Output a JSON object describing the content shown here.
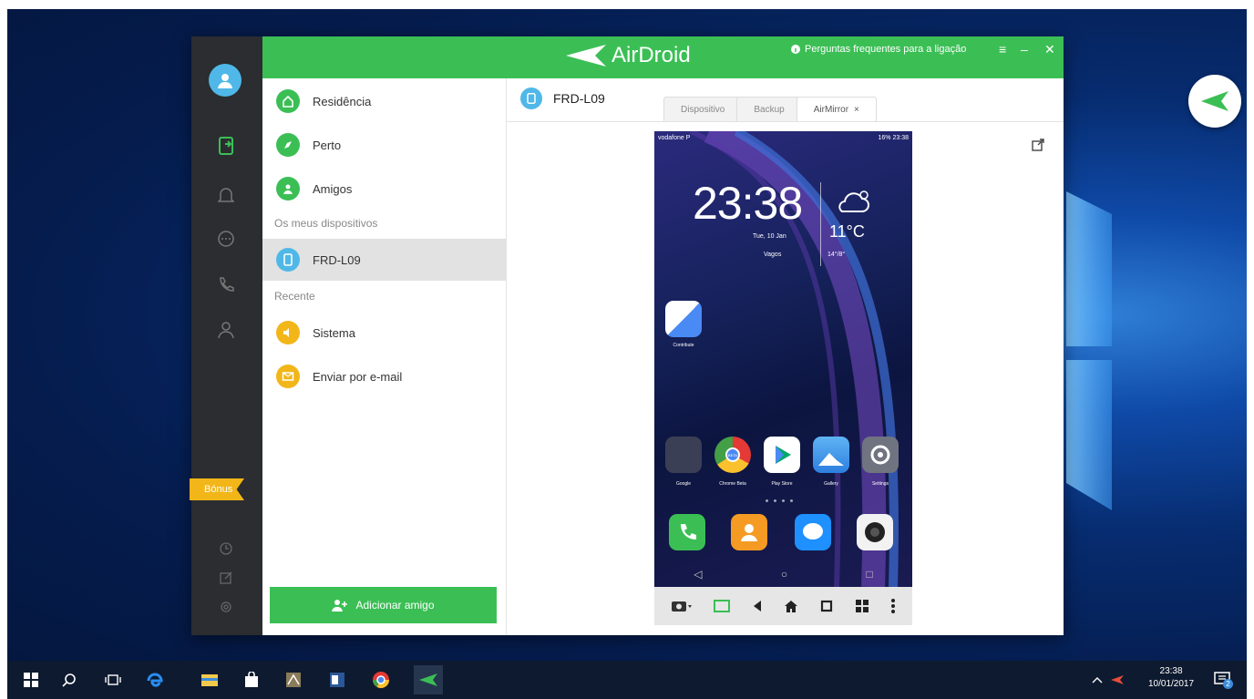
{
  "app": {
    "brand": "AirDroid",
    "faq_label": "Perguntas frequentes para a ligação",
    "window_controls": [
      "≡",
      "–",
      "✕"
    ],
    "bonus_label": "Bónus"
  },
  "sidebar": {
    "items": [
      {
        "label": "Residência",
        "color": "#3bbf55",
        "icon": "home-icon"
      },
      {
        "label": "Perto",
        "color": "#3bbf55",
        "icon": "compass-icon"
      },
      {
        "label": "Amigos",
        "color": "#3bbf55",
        "icon": "friends-icon"
      }
    ],
    "section_devices": "Os meus dispositivos",
    "device": {
      "label": "FRD-L09",
      "color": "#4fb8e8",
      "icon": "phone-icon"
    },
    "section_recent": "Recente",
    "recent": [
      {
        "label": "Sistema",
        "color": "#f2b619",
        "icon": "speaker-icon"
      },
      {
        "label": "Enviar por e-mail",
        "color": "#f2b619",
        "icon": "mail-icon"
      }
    ],
    "add_friend": "Adicionar amigo"
  },
  "main": {
    "device_name": "FRD-L09",
    "tabs": [
      {
        "label": "Dispositivo",
        "active": false
      },
      {
        "label": "Backup",
        "active": false
      },
      {
        "label": "AirMirror",
        "active": true,
        "close": "×"
      }
    ]
  },
  "phone": {
    "carrier": "vodafone P",
    "status_right": "16% 23:38",
    "time": "23:38",
    "date": "Tue, 10 Jan",
    "location": "Vagos",
    "temperature": "11°C",
    "range": "14°/8°",
    "single_app": "Contribute",
    "apps": [
      "Google",
      "Chrome Beta",
      "Play Store",
      "Gallery",
      "Settings"
    ],
    "beta_label": "BETA"
  },
  "taskbar": {
    "time": "23:38",
    "date": "10/01/2017",
    "notif_count": "2"
  }
}
